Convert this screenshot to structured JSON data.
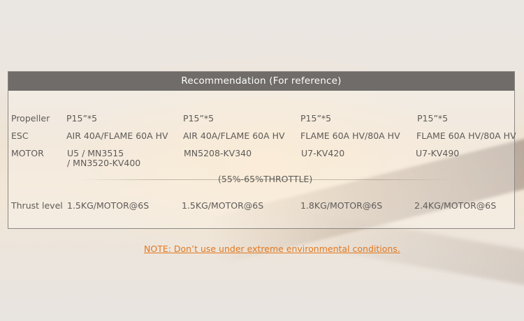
{
  "header": {
    "title": "Recommendation (For reference)"
  },
  "table": {
    "rows": [
      {
        "label": "Propeller",
        "values": [
          "P15”*5",
          "P15”*5",
          "P15”*5",
          "P15”*5"
        ]
      },
      {
        "label": "ESC",
        "values": [
          "AIR 40A/FLAME 60A HV",
          "AIR 40A/FLAME 60A HV",
          "FLAME 60A HV/80A HV",
          "FLAME 60A HV/80A HV"
        ]
      },
      {
        "label": "MOTOR",
        "values": [
          "U5 / MN3515",
          "MN5208-KV340",
          "U7-KV420",
          "U7-KV490"
        ],
        "extra": "/ MN3520-KV400"
      }
    ],
    "throttle": "(55%-65%THROTTLE)",
    "thrust": {
      "label": "Thrust level",
      "values": [
        "1.5KG/MOTOR@6S",
        "1.5KG/MOTOR@6S",
        "1.8KG/MOTOR@6S",
        "2.4KG/MOTOR@6S"
      ]
    }
  },
  "note": "NOTE: Don’t use under extreme environmental conditions.",
  "colors": {
    "header_bg": "#6f6c69",
    "note": "#e2781f",
    "text": "#5e5b58"
  }
}
